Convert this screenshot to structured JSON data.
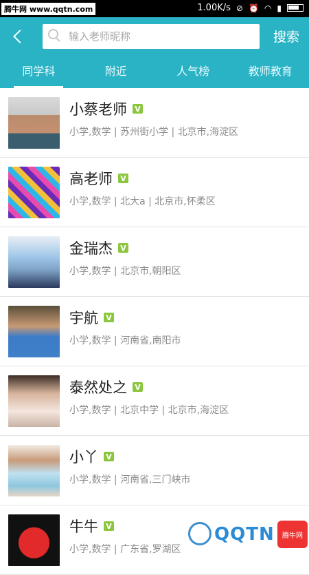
{
  "status": {
    "watermark": "腾牛网 www.qqtn.com",
    "speed": "1.00K/s"
  },
  "header": {
    "search_placeholder": "输入老师昵称",
    "search_label": "搜索"
  },
  "tabs": [
    {
      "label": "同学科"
    },
    {
      "label": "附近"
    },
    {
      "label": "人气榜"
    },
    {
      "label": "教师教育"
    }
  ],
  "teachers": [
    {
      "name": "小蔡老师",
      "detail": "小学,数学 | 苏州街小学 | 北京市,海淀区"
    },
    {
      "name": "高老师",
      "detail": "小学,数学 | 北大a | 北京市,怀柔区"
    },
    {
      "name": "金瑞杰",
      "detail": "小学,数学 | 北京市,朝阳区"
    },
    {
      "name": "宇航",
      "detail": "小学,数学 | 河南省,南阳市"
    },
    {
      "name": "泰然处之",
      "detail": "小学,数学 | 北京中学 | 北京市,海淀区"
    },
    {
      "name": "小丫",
      "detail": "小学,数学 | 河南省,三门峡市"
    },
    {
      "name": "牛牛",
      "detail": "小学,数学 | 广东省,罗湖区"
    }
  ],
  "verified_mark": "V",
  "watermark2": {
    "text": "QQTN",
    "badge": "腾牛网"
  }
}
